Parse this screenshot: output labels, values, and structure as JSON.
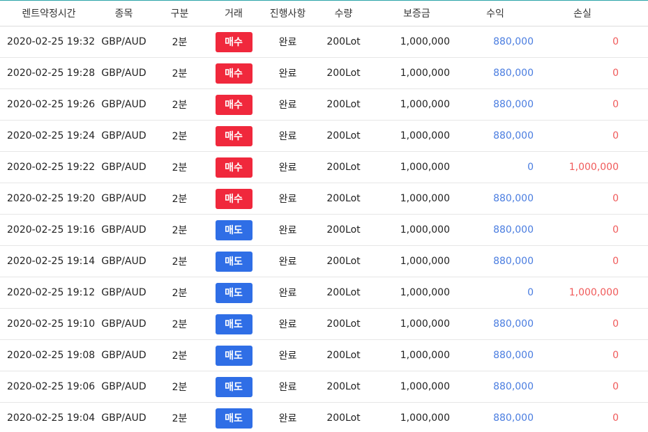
{
  "headers": {
    "time": "렌트약정시간",
    "symbol": "종목",
    "period": "구분",
    "trade": "거래",
    "status": "진행사항",
    "qty": "수량",
    "margin": "보증금",
    "profit": "수익",
    "loss": "손실"
  },
  "colors": {
    "buy": "#f0283c",
    "sell": "#2f6ee6",
    "profit": "#4a7de0",
    "loss": "#f05a5a",
    "top_border": "#2aa3a8"
  },
  "rows": [
    {
      "time": "2020-02-25 19:32",
      "symbol": "GBP/AUD",
      "period": "2분",
      "trade": "매수",
      "trade_type": "buy",
      "status": "완료",
      "qty": "200Lot",
      "margin": "1,000,000",
      "profit": "880,000",
      "loss": "0"
    },
    {
      "time": "2020-02-25 19:28",
      "symbol": "GBP/AUD",
      "period": "2분",
      "trade": "매수",
      "trade_type": "buy",
      "status": "완료",
      "qty": "200Lot",
      "margin": "1,000,000",
      "profit": "880,000",
      "loss": "0"
    },
    {
      "time": "2020-02-25 19:26",
      "symbol": "GBP/AUD",
      "period": "2분",
      "trade": "매수",
      "trade_type": "buy",
      "status": "완료",
      "qty": "200Lot",
      "margin": "1,000,000",
      "profit": "880,000",
      "loss": "0"
    },
    {
      "time": "2020-02-25 19:24",
      "symbol": "GBP/AUD",
      "period": "2분",
      "trade": "매수",
      "trade_type": "buy",
      "status": "완료",
      "qty": "200Lot",
      "margin": "1,000,000",
      "profit": "880,000",
      "loss": "0"
    },
    {
      "time": "2020-02-25 19:22",
      "symbol": "GBP/AUD",
      "period": "2분",
      "trade": "매수",
      "trade_type": "buy",
      "status": "완료",
      "qty": "200Lot",
      "margin": "1,000,000",
      "profit": "0",
      "loss": "1,000,000"
    },
    {
      "time": "2020-02-25 19:20",
      "symbol": "GBP/AUD",
      "period": "2분",
      "trade": "매수",
      "trade_type": "buy",
      "status": "완료",
      "qty": "200Lot",
      "margin": "1,000,000",
      "profit": "880,000",
      "loss": "0"
    },
    {
      "time": "2020-02-25 19:16",
      "symbol": "GBP/AUD",
      "period": "2분",
      "trade": "매도",
      "trade_type": "sell",
      "status": "완료",
      "qty": "200Lot",
      "margin": "1,000,000",
      "profit": "880,000",
      "loss": "0"
    },
    {
      "time": "2020-02-25 19:14",
      "symbol": "GBP/AUD",
      "period": "2분",
      "trade": "매도",
      "trade_type": "sell",
      "status": "완료",
      "qty": "200Lot",
      "margin": "1,000,000",
      "profit": "880,000",
      "loss": "0"
    },
    {
      "time": "2020-02-25 19:12",
      "symbol": "GBP/AUD",
      "period": "2분",
      "trade": "매도",
      "trade_type": "sell",
      "status": "완료",
      "qty": "200Lot",
      "margin": "1,000,000",
      "profit": "0",
      "loss": "1,000,000"
    },
    {
      "time": "2020-02-25 19:10",
      "symbol": "GBP/AUD",
      "period": "2분",
      "trade": "매도",
      "trade_type": "sell",
      "status": "완료",
      "qty": "200Lot",
      "margin": "1,000,000",
      "profit": "880,000",
      "loss": "0"
    },
    {
      "time": "2020-02-25 19:08",
      "symbol": "GBP/AUD",
      "period": "2분",
      "trade": "매도",
      "trade_type": "sell",
      "status": "완료",
      "qty": "200Lot",
      "margin": "1,000,000",
      "profit": "880,000",
      "loss": "0"
    },
    {
      "time": "2020-02-25 19:06",
      "symbol": "GBP/AUD",
      "period": "2분",
      "trade": "매도",
      "trade_type": "sell",
      "status": "완료",
      "qty": "200Lot",
      "margin": "1,000,000",
      "profit": "880,000",
      "loss": "0"
    },
    {
      "time": "2020-02-25 19:04",
      "symbol": "GBP/AUD",
      "period": "2분",
      "trade": "매도",
      "trade_type": "sell",
      "status": "완료",
      "qty": "200Lot",
      "margin": "1,000,000",
      "profit": "880,000",
      "loss": "0"
    }
  ]
}
